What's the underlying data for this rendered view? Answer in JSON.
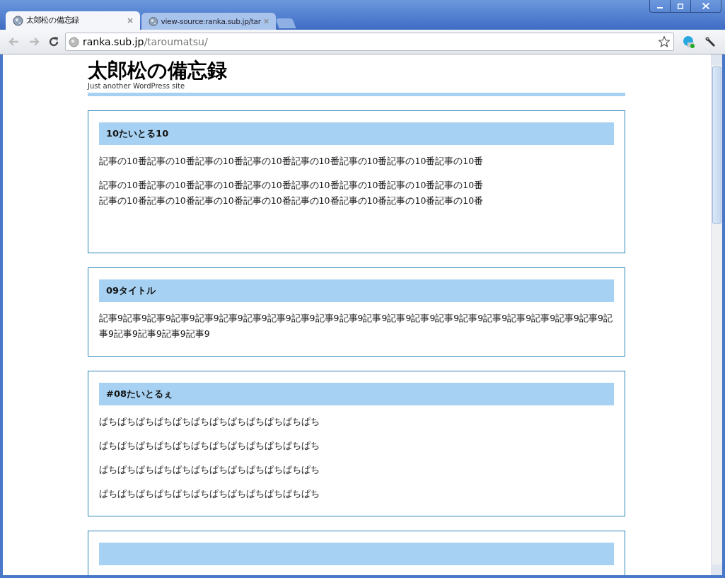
{
  "tabs": [
    {
      "title": "太郎松の備忘録",
      "selected": true
    },
    {
      "title": "view-source:ranka.sub.jp/tar",
      "selected": false
    }
  ],
  "address_bar": {
    "host": "ranka.sub.jp",
    "path": "/taroumatsu/"
  },
  "site": {
    "title": "太郎松の備忘録",
    "tagline": "Just another WordPress site"
  },
  "posts": [
    {
      "title": "10たいとる10",
      "paragraphs": [
        [
          "記事の10番記事の10番記事の10番記事の10番記事の10番記事の10番記事の10番記事の10番"
        ],
        [
          "記事の10番記事の10番記事の10番記事の10番記事の10番記事の10番記事の10番記事の10番",
          "記事の10番記事の10番記事の10番記事の10番記事の10番記事の10番記事の10番記事の10番"
        ]
      ]
    },
    {
      "title": "09タイトル",
      "paragraphs": [
        [
          "記事9記事9記事9記事9記事9記事9記事9記事9記事9記事9記事9記事9記事9記事9記事9記事9記事9記事9記事9記事9記事9記事9記事9記事9記事9記事9"
        ]
      ]
    },
    {
      "title": "#08たいとるぇ",
      "paragraphs": [
        [
          "ぱちぱちぱちぱちぱちぱちぱちぱちぱちぱちぱちぱち"
        ],
        [
          "ぱちぱちぱちぱちぱちぱちぱちぱちぱちぱちぱちぱち"
        ],
        [
          "ぱちぱちぱちぱちぱちぱちぱちぱちぱちぱちぱちぱち"
        ],
        [
          "ぱちぱちぱちぱちぱちぱちぱちぱちぱちぱちぱちぱち"
        ]
      ]
    }
  ]
}
